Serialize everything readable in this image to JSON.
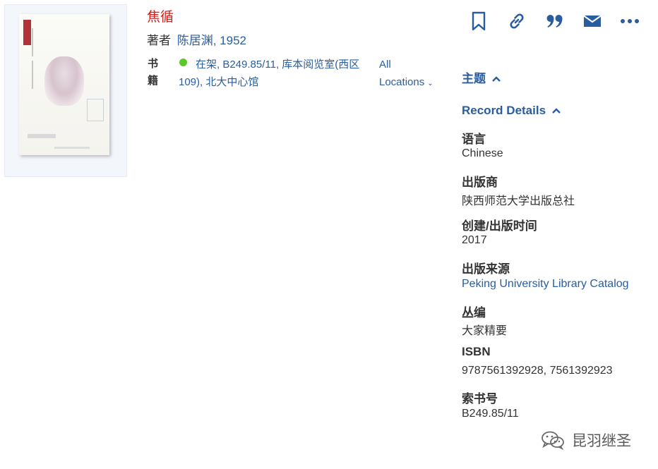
{
  "record": {
    "title": "焦循",
    "author_label": "著者",
    "author": "陈居渊, 1952",
    "format_label": "书籍",
    "availability": "在架, B249.85/11, 库本阅览室(西区109), 北大中心馆",
    "all_locations_label": "All Locations",
    "availability_color": "#5ac72b"
  },
  "actions": [
    {
      "icon": "bookmark-icon"
    },
    {
      "icon": "link-icon"
    },
    {
      "icon": "quote-icon"
    },
    {
      "icon": "mail-icon"
    },
    {
      "icon": "more-icon"
    }
  ],
  "panel": {
    "subjects_heading": "主题",
    "details_heading": "Record Details",
    "fields": {
      "language": {
        "label": "语言",
        "value": "Chinese"
      },
      "publisher": {
        "label": "出版商",
        "value": "陕西师范大学出版总社"
      },
      "date": {
        "label": "创建/出版时间",
        "value": "2017"
      },
      "source": {
        "label": "出版来源",
        "value": "Peking University Library Catalog"
      },
      "series": {
        "label": "丛编",
        "value": "大家精要"
      },
      "isbn": {
        "label": "ISBN",
        "value": "9787561392928, 7561392923"
      },
      "call_number": {
        "label": "索书号",
        "value": "B249.85/11"
      }
    }
  },
  "watermark": {
    "text": "昆羽继圣"
  },
  "colors": {
    "title": "#d0201b",
    "link": "#2a5d9f",
    "text": "#333333"
  }
}
